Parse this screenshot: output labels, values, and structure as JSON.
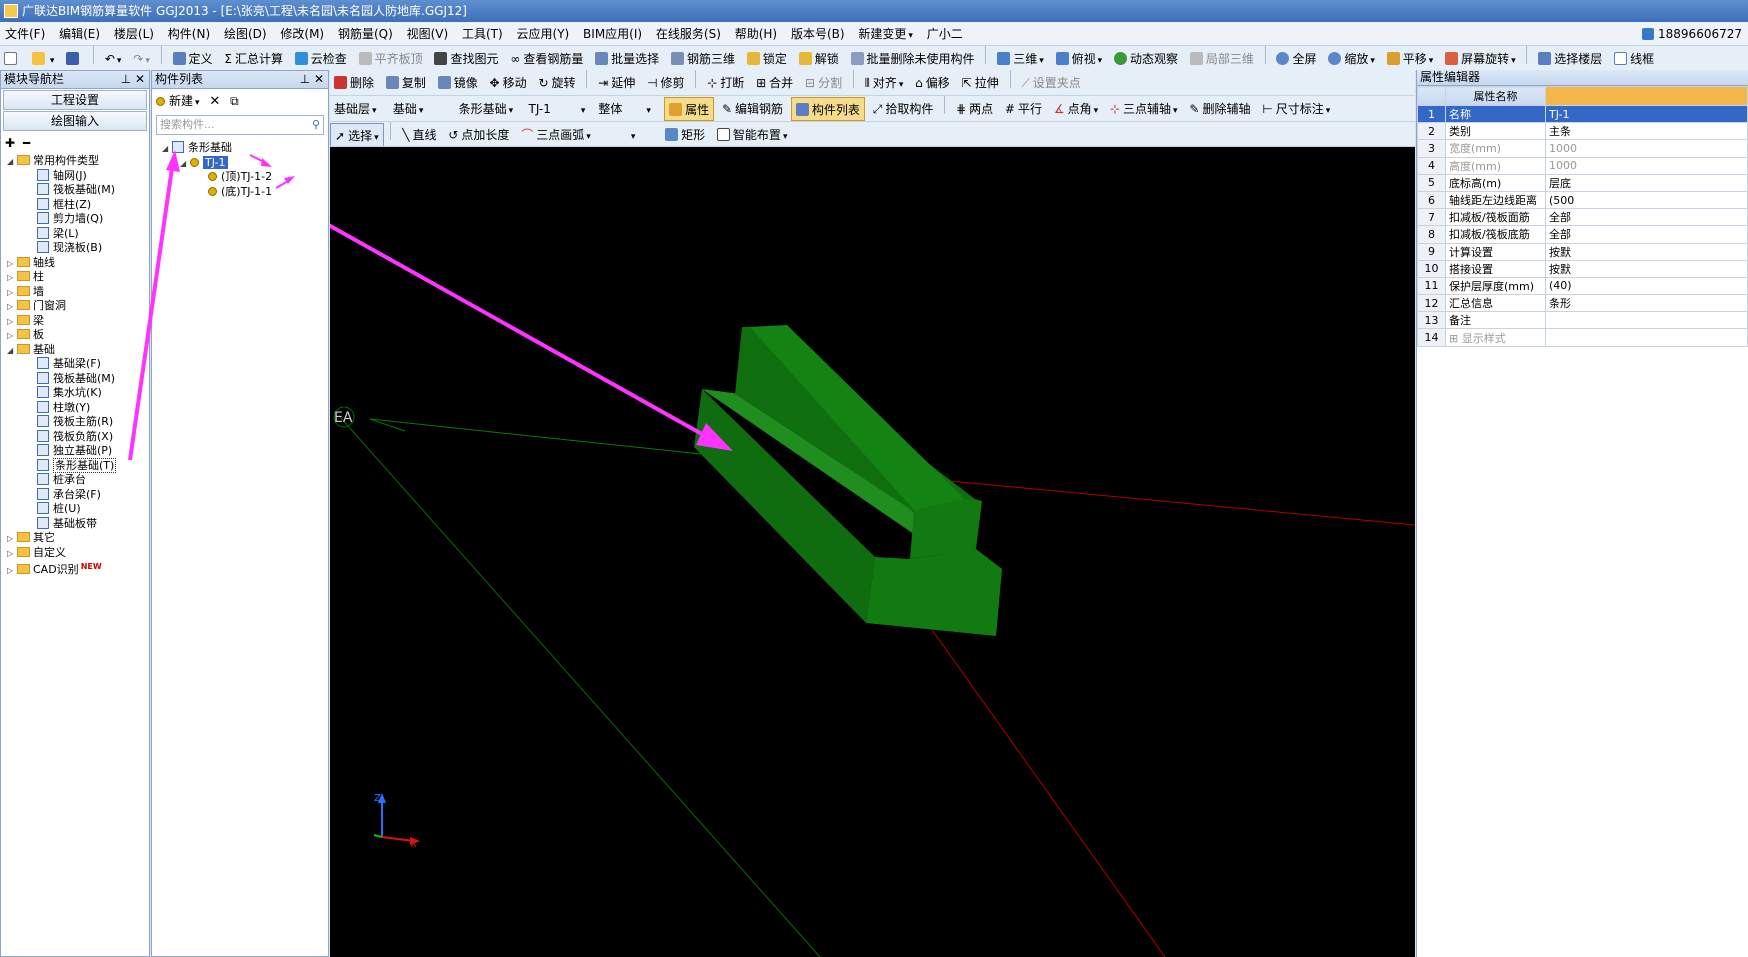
{
  "title": "广联达BIM钢筋算量软件 GGJ2013 - [E:\\张亮\\工程\\未名园\\未名园人防地库.GGJ12]",
  "menu": {
    "items": [
      "文件(F)",
      "编辑(E)",
      "楼层(L)",
      "构件(N)",
      "绘图(D)",
      "修改(M)",
      "钢筋量(Q)",
      "视图(V)",
      "工具(T)",
      "云应用(Y)",
      "BIM应用(I)",
      "在线服务(S)",
      "帮助(H)",
      "版本号(B)",
      "新建变更",
      "广小二"
    ],
    "phone": "18896606727"
  },
  "toolbar1": [
    "定义",
    "汇总计算",
    "云检查",
    "平齐板顶",
    "查找图元",
    "查看钢筋量",
    "批量选择",
    "钢筋三维",
    "锁定",
    "解锁",
    "批量删除未使用构件",
    "三维",
    "俯视",
    "动态观察",
    "局部三维",
    "全屏",
    "缩放",
    "平移",
    "屏幕旋转",
    "选择楼层",
    "线框"
  ],
  "toolbar2": [
    "删除",
    "复制",
    "镜像",
    "移动",
    "旋转",
    "延伸",
    "修剪",
    "打断",
    "合并",
    "分割",
    "对齐",
    "偏移",
    "拉伸",
    "设置夹点"
  ],
  "toolbar3": {
    "selects": [
      "基础层",
      "基础",
      "条形基础",
      "TJ-1",
      "整体"
    ],
    "buttons": [
      "属性",
      "编辑钢筋",
      "构件列表",
      "拾取构件",
      "两点",
      "平行",
      "点角",
      "三点辅轴",
      "删除辅轴",
      "尺寸标注"
    ]
  },
  "toolbar4": [
    "选择",
    "直线",
    "点加长度",
    "三点画弧",
    "矩形",
    "智能布置"
  ],
  "nav": {
    "title": "模块导航栏",
    "btn1": "工程设置",
    "btn2": "绘图输入",
    "tree": [
      {
        "label": "常用构件类型",
        "level": 0,
        "type": "folder",
        "open": true
      },
      {
        "label": "轴网(J)",
        "level": 1,
        "type": "comp"
      },
      {
        "label": "筏板基础(M)",
        "level": 1,
        "type": "comp"
      },
      {
        "label": "框柱(Z)",
        "level": 1,
        "type": "comp"
      },
      {
        "label": "剪力墙(Q)",
        "level": 1,
        "type": "comp"
      },
      {
        "label": "梁(L)",
        "level": 1,
        "type": "comp"
      },
      {
        "label": "现浇板(B)",
        "level": 1,
        "type": "comp"
      },
      {
        "label": "轴线",
        "level": 0,
        "type": "folder"
      },
      {
        "label": "柱",
        "level": 0,
        "type": "folder"
      },
      {
        "label": "墙",
        "level": 0,
        "type": "folder"
      },
      {
        "label": "门窗洞",
        "level": 0,
        "type": "folder"
      },
      {
        "label": "梁",
        "level": 0,
        "type": "folder"
      },
      {
        "label": "板",
        "level": 0,
        "type": "folder"
      },
      {
        "label": "基础",
        "level": 0,
        "type": "folder",
        "open": true
      },
      {
        "label": "基础梁(F)",
        "level": 1,
        "type": "comp"
      },
      {
        "label": "筏板基础(M)",
        "level": 1,
        "type": "comp"
      },
      {
        "label": "集水坑(K)",
        "level": 1,
        "type": "comp"
      },
      {
        "label": "柱墩(Y)",
        "level": 1,
        "type": "comp"
      },
      {
        "label": "筏板主筋(R)",
        "level": 1,
        "type": "comp"
      },
      {
        "label": "筏板负筋(X)",
        "level": 1,
        "type": "comp"
      },
      {
        "label": "独立基础(P)",
        "level": 1,
        "type": "comp"
      },
      {
        "label": "条形基础(T)",
        "level": 1,
        "type": "comp",
        "boxed": true
      },
      {
        "label": "桩承台",
        "level": 1,
        "type": "comp"
      },
      {
        "label": "承台梁(F)",
        "level": 1,
        "type": "comp"
      },
      {
        "label": "桩(U)",
        "level": 1,
        "type": "comp"
      },
      {
        "label": "基础板带",
        "level": 1,
        "type": "comp"
      },
      {
        "label": "其它",
        "level": 0,
        "type": "folder"
      },
      {
        "label": "自定义",
        "level": 0,
        "type": "folder"
      },
      {
        "label": "CAD识别",
        "level": 0,
        "type": "folder",
        "badge": "NEW"
      }
    ]
  },
  "complist": {
    "title": "构件列表",
    "new_label": "新建",
    "search_placeholder": "搜索构件...",
    "tree": [
      {
        "label": "条形基础",
        "level": 0
      },
      {
        "label": "TJ-1",
        "level": 1,
        "selected": true
      },
      {
        "label": "(顶)TJ-1-2",
        "level": 2
      },
      {
        "label": "(底)TJ-1-1",
        "level": 2
      }
    ]
  },
  "viewport": {
    "axis_label": "EA"
  },
  "props": {
    "title": "属性编辑器",
    "header": "属性名称",
    "rows": [
      {
        "n": "1",
        "name": "名称",
        "val": "TJ-1",
        "sel": true
      },
      {
        "n": "2",
        "name": "类别",
        "val": "主条"
      },
      {
        "n": "3",
        "name": "宽度(mm)",
        "val": "1000",
        "dim": true
      },
      {
        "n": "4",
        "name": "高度(mm)",
        "val": "1000",
        "dim": true
      },
      {
        "n": "5",
        "name": "底标高(m)",
        "val": "层底"
      },
      {
        "n": "6",
        "name": "轴线距左边线距离",
        "val": "(500"
      },
      {
        "n": "7",
        "name": "扣减板/筏板面筋",
        "val": "全部"
      },
      {
        "n": "8",
        "name": "扣减板/筏板底筋",
        "val": "全部"
      },
      {
        "n": "9",
        "name": "计算设置",
        "val": "按默"
      },
      {
        "n": "10",
        "name": "搭接设置",
        "val": "按默"
      },
      {
        "n": "11",
        "name": "保护层厚度(mm)",
        "val": "(40)"
      },
      {
        "n": "12",
        "name": "汇总信息",
        "val": "条形"
      },
      {
        "n": "13",
        "name": "备注",
        "val": ""
      },
      {
        "n": "14",
        "name": "显示样式",
        "val": "",
        "dim": true,
        "plus": true
      }
    ]
  },
  "colors": {
    "accent": "#3367c8",
    "beam": "#117a11",
    "arrow": "#ff33ff"
  }
}
